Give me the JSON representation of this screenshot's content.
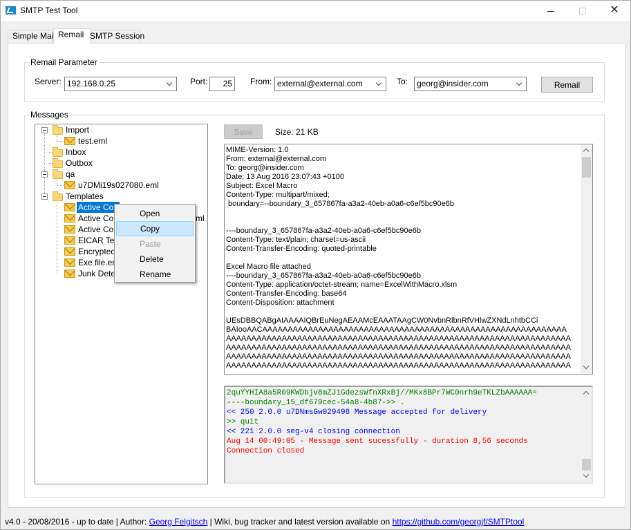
{
  "window": {
    "title": "SMTP Test Tool",
    "accent": "#0078d7"
  },
  "tabs": [
    {
      "label": "Simple Mail"
    },
    {
      "label": "Remail"
    },
    {
      "label": "SMTP Session"
    }
  ],
  "remail_parameter": {
    "group_title": "Remail Parameter",
    "server_label": "Server:",
    "server_value": "192.168.0.25",
    "port_label": "Port:",
    "port_value": "25",
    "from_label": "From:",
    "from_value": "external@external.com",
    "to_label": "To:",
    "to_value": "georg@insider.com",
    "remail_button": "Remail"
  },
  "messages": {
    "group_title": "Messages",
    "save_button": "Save",
    "size_text": "Size: 21 KB",
    "tree": {
      "import": "Import",
      "import_file": "test.eml",
      "inbox": "Inbox",
      "outbox": "Outbox",
      "qa": "qa",
      "qa_file": "u7DMi19s027080.eml",
      "templates": "Templates",
      "tpl1": "Active Con",
      "tpl2": "Active Con",
      "tpl2_suffix": "ml",
      "tpl3": "Active Con",
      "tpl4": "EICAR Tes",
      "tpl5": "Encrypted",
      "tpl6": "Exe file.em",
      "tpl7": "Junk Detec"
    },
    "context_menu": {
      "open": "Open",
      "copy": "Copy",
      "paste": "Paste",
      "delete": "Delete",
      "rename": "Rename"
    },
    "mime_lines": [
      "MIME-Version: 1.0",
      "From: external@external.com",
      "To: georg@insider.com",
      "Date: 13 Aug 2016 23:07:43 +0100",
      "Subject: Excel Macro",
      "Content-Type: multipart/mixed;",
      " boundary=--boundary_3_657867fa-a3a2-40eb-a0a6-c6ef5bc90e6b",
      "",
      "",
      "----boundary_3_657867fa-a3a2-40eb-a0a6-c6ef5bc90e6b",
      "Content-Type: text/plain; charset=us-ascii",
      "Content-Transfer-Encoding: quoted-printable",
      "",
      "Excel Macro file attached",
      "----boundary_3_657867fa-a3a2-40eb-a0a6-c6ef5bc90e6b",
      "Content-Type: application/octet-stream; name=ExcelWithMacro.xlsm",
      "Content-Transfer-Encoding: base64",
      "Content-Disposition: attachment",
      "",
      "UEsDBBQABgAIAAAAIQBrEuNegAEAAMcEAAATAAgCW0NvbnRlbnRfVHlwZXNdLnhtbCCi",
      "BAIooAACAAAAAAAAAAAAAAAAAAAAAAAAAAAAAAAAAAAAAAAAAAAAAAAAAAAAAAAAAAAA",
      "AAAAAAAAAAAAAAAAAAAAAAAAAAAAAAAAAAAAAAAAAAAAAAAAAAAAAAAAAAAAAAAAAAAA",
      "AAAAAAAAAAAAAAAAAAAAAAAAAAAAAAAAAAAAAAAAAAAAAAAAAAAAAAAAAAAAAAAAAAAA",
      "AAAAAAAAAAAAAAAAAAAAAAAAAAAAAAAAAAAAAAAAAAAAAAAAAAAAAAAAAAAAAAAAAAAA",
      "AAAAAAAAAAAAAAAAAAAAAAAAAAAAAAAAAAAAAAAAAAAAAAAAAAAAAAAAAAAAAAAAAAAA"
    ],
    "session_log": [
      {
        "text": "2quYYHIA8a5R09KWDbjv8mZJ1GdezsWfnXRxBj//MKx8BPr7WC0nrh9eTKLZbAAAAAA=",
        "color": "#008000"
      },
      {
        "text": "----boundary_15_df679cec-54a8-4b87->> .",
        "color": "#008000"
      },
      {
        "text": "<< 250 2.0.0 u7DNmsGw029498 Message accepted for delivery",
        "color": "#0000ff"
      },
      {
        "text": ">> quit",
        "color": "#008000"
      },
      {
        "text": "<< 221 2.0.0 seg-v4 closing connection",
        "color": "#0000ff"
      },
      {
        "text": "Aug 14 00:49:05 - Message sent sucessfully - duration 8,56 seconds",
        "color": "#ff0000"
      },
      {
        "text": "Connection closed",
        "color": "#ff0000"
      }
    ]
  },
  "status": {
    "version_text": "v4.0  -  20/08/2016  -  up to date  |  Author:",
    "author_link": "Georg Felgitsch",
    "wiki_text": "|  Wiki, bug tracker and latest version available on",
    "github_link": "https://github.com/georgjf/SMTPtool"
  }
}
